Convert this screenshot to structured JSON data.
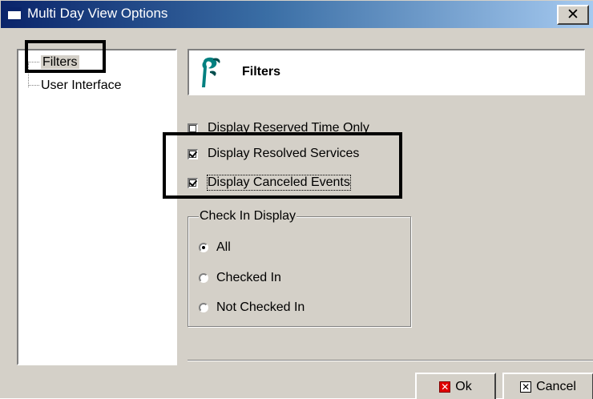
{
  "window": {
    "title": "Multi Day View Options",
    "close_symbol": "✕"
  },
  "tree": {
    "items": [
      {
        "label": "Filters",
        "selected": true
      },
      {
        "label": "User Interface",
        "selected": false
      }
    ]
  },
  "header": {
    "icon": "filters-logo-icon",
    "title": "Filters"
  },
  "checkboxes": [
    {
      "label": "Display Reserved Time Only",
      "checked": false
    },
    {
      "label": "Display Resolved Services",
      "checked": true
    },
    {
      "label": "Display Canceled Events",
      "checked": true
    }
  ],
  "check_in_display": {
    "legend": "Check In Display",
    "options": [
      {
        "label": "All",
        "selected": true
      },
      {
        "label": "Checked In",
        "selected": false
      },
      {
        "label": "Not Checked In",
        "selected": false
      }
    ]
  },
  "buttons": {
    "ok_label": "Ok",
    "ok_icon": "red-x-icon",
    "cancel_label": "Cancel",
    "cancel_icon": "x-box-icon"
  },
  "colors": {
    "titlebar_start": "#0a246a",
    "titlebar_end": "#a6caf0",
    "face": "#d4d0c8",
    "ok_icon": "#e00000"
  }
}
